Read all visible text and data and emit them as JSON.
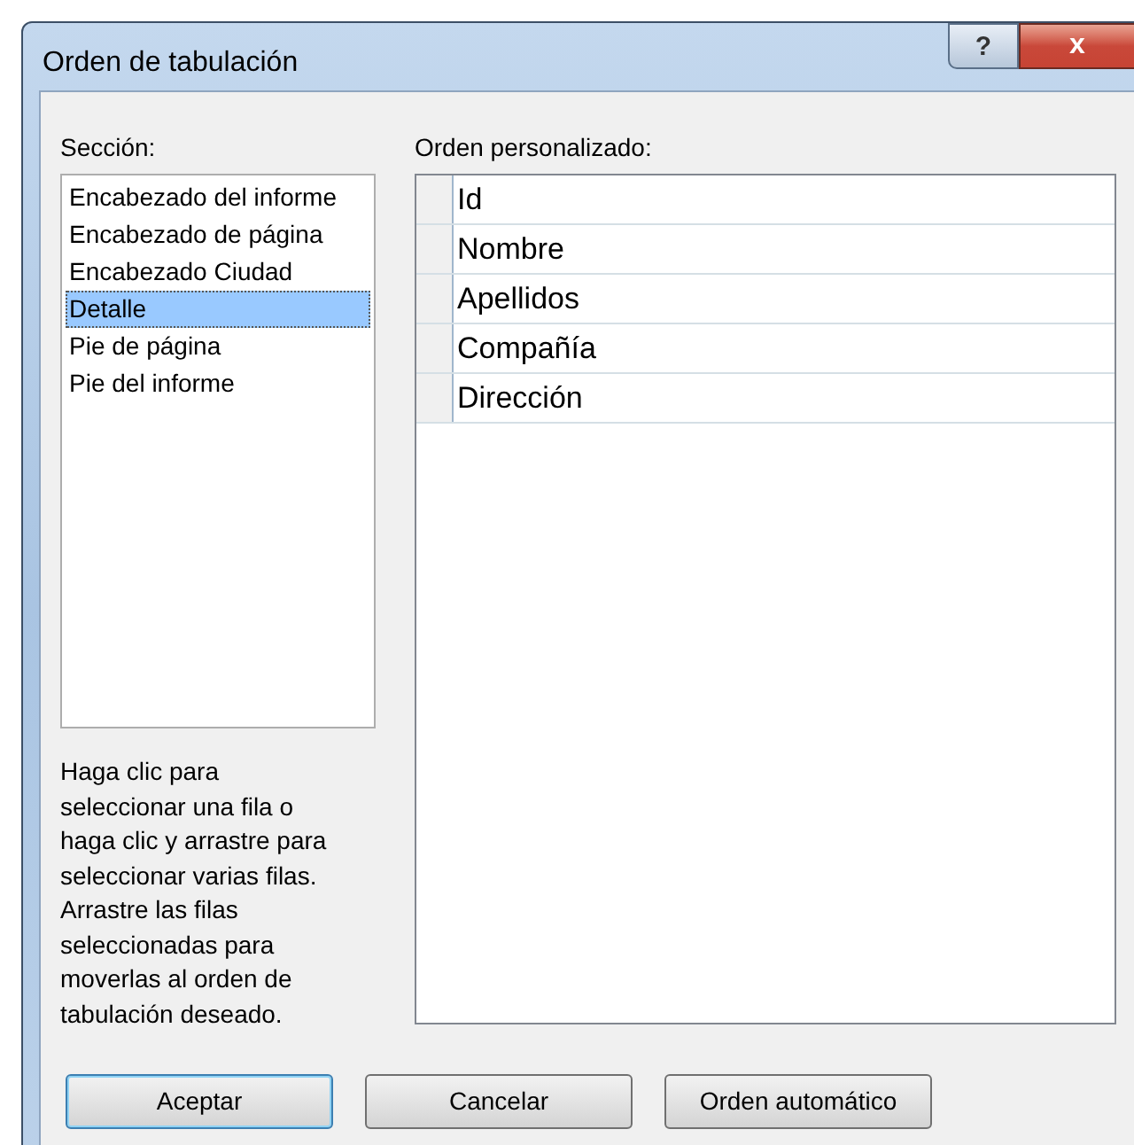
{
  "window": {
    "title": "Orden de tabulación",
    "help_button": "?",
    "close_button": "x"
  },
  "section": {
    "label": "Sección:",
    "items": [
      {
        "label": "Encabezado del informe",
        "selected": false
      },
      {
        "label": "Encabezado de página",
        "selected": false
      },
      {
        "label": "Encabezado Ciudad",
        "selected": false
      },
      {
        "label": "Detalle",
        "selected": true
      },
      {
        "label": "Pie de página",
        "selected": false
      },
      {
        "label": "Pie del informe",
        "selected": false
      }
    ]
  },
  "help_text": "Haga clic para\nseleccionar una fila o\nhaga clic y arrastre para\nseleccionar varias filas.\nArrastre las filas\nseleccionadas para\nmoverlas al orden de\ntabulación deseado.",
  "custom_order": {
    "label": "Orden personalizado:",
    "rows": [
      "Id",
      "Nombre",
      "Apellidos",
      "Compañía",
      "Dirección"
    ]
  },
  "buttons": [
    {
      "label": "Aceptar",
      "default": true
    },
    {
      "label": "Cancelar",
      "default": false
    },
    {
      "label": "Orden automático",
      "default": false
    }
  ]
}
